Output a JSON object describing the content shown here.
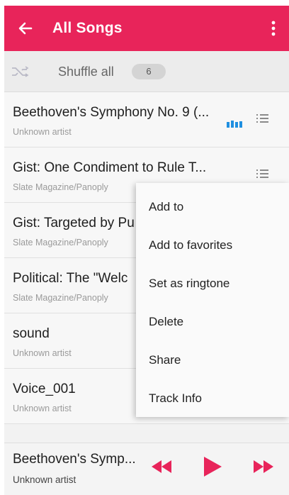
{
  "app_bar": {
    "title": "All Songs",
    "color": "#e8245a"
  },
  "shuffle": {
    "label": "Shuffle all",
    "count": "6"
  },
  "songs": [
    {
      "name": "Beethoven's Symphony No. 9 (...",
      "artist": "Unknown artist",
      "playing": true
    },
    {
      "name": "Gist: One Condiment to Rule T...",
      "artist": "Slate Magazine/Panoply"
    },
    {
      "name": "Gist: Targeted by Pu",
      "artist": "Slate Magazine/Panoply"
    },
    {
      "name": "Political: The \"Welc",
      "artist": "Slate Magazine/Panoply"
    },
    {
      "name": "sound",
      "artist": "Unknown artist"
    },
    {
      "name": "Voice_001",
      "artist": "Unknown artist"
    }
  ],
  "context_menu": {
    "items": [
      "Add to",
      "Add to favorites",
      "Set as ringtone",
      "Delete",
      "Share",
      "Track Info"
    ]
  },
  "now_playing": {
    "title": "Beethoven's Symp...",
    "artist": "Unknown artist",
    "accent_color": "#e8245a"
  },
  "icons": {
    "back": "arrow-left-icon",
    "more": "more-vert-icon",
    "shuffle": "shuffle-icon",
    "playing": "equalizer-icon",
    "item_menu": "list-menu-icon",
    "rewind": "rewind-icon",
    "play": "play-icon",
    "forward": "fast-forward-icon"
  }
}
